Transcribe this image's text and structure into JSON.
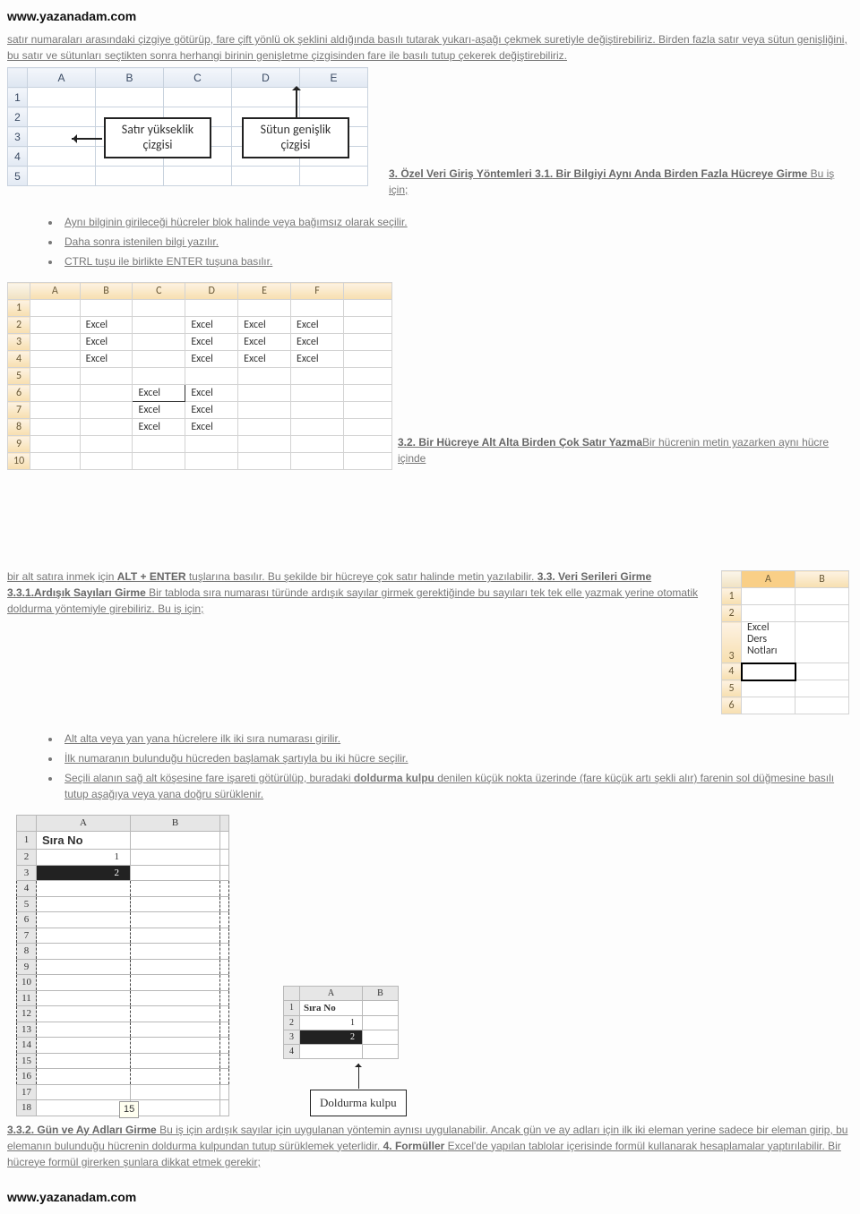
{
  "site": "www.yazanadam.com",
  "intro": "satır numaraları arasındaki çizgiye götürüp, fare çift yönlü ok şeklini aldığında basılı tutarak yukarı-aşağı çekmek suretiyle değiştirebiliriz. Birden fazla satır veya sütun genişliğini, bu satır ve sütunları seçtikten sonra herhangi birinin genişletme çizgisinden fare ile basılı tutup çekerek değiştirebiliriz.",
  "fig1": {
    "cols": [
      "A",
      "B",
      "C",
      "D",
      "E"
    ],
    "rows": [
      "1",
      "2",
      "3",
      "4",
      "5"
    ],
    "callout_row": "Satır yükseklik çizgisi",
    "callout_col": "Sütun genişlik çizgisi"
  },
  "sec3": {
    "heading": " 3. Özel Veri Giriş Yöntemleri 3.1. Bir Bilgiyi Aynı Anda Birden Fazla Hücreye Girme ",
    "tail": "Bu iş için;"
  },
  "bullets3_1": [
    "Aynı bilginin girileceği hücreler blok halinde veya bağımsız olarak seçilir.",
    "Daha sonra istenilen bilgi yazılır.",
    "CTRL tuşu ile birlikte ENTER tuşuna basılır."
  ],
  "fig2": {
    "cols": [
      "A",
      "B",
      "C",
      "D",
      "E",
      "F"
    ],
    "rows": [
      "1",
      "2",
      "3",
      "4",
      "5",
      "6",
      "7",
      "8",
      "9",
      "10"
    ],
    "cells": {
      "B2": "Excel",
      "D2": "Excel",
      "E2": "Excel",
      "F2": "Excel",
      "B3": "Excel",
      "D3": "Excel",
      "E3": "Excel",
      "F3": "Excel",
      "B4": "Excel",
      "D4": "Excel",
      "E4": "Excel",
      "F4": "Excel",
      "C6": "Excel",
      "D6": "Excel",
      "C7": "Excel",
      "D7": "Excel",
      "C8": "Excel",
      "D8": "Excel"
    }
  },
  "sec32": {
    "heading": " 3.2. Bir Hücreye Alt Alta Birden Çok Satır Yazma",
    "tail": "Bir hücrenin metin yazarken aynı hücre içinde"
  },
  "fig3": {
    "cols": [
      "A",
      "B"
    ],
    "rows": [
      "1",
      "2",
      "3",
      "4",
      "5",
      "6"
    ],
    "multiline": "Excel\nDers\nNotları"
  },
  "sec33_pre": "bir alt satıra inmek için ",
  "sec33_key": "ALT + ENTER",
  "sec33_post": " tuşlarına basılır. Bu şekilde bir hücreye çok satır halinde metin yazılabilir.",
  "sec33_head": " 3.3. Veri Serileri Girme 3.3.1.Ardışık Sayıları Girme ",
  "sec33_body": "Bir tabloda sıra numarası türünde ardışık sayılar girmek gerektiğinde bu sayıları tek tek elle yazmak yerine otomatik doldurma yöntemiyle girebiliriz. Bu iş için;",
  "bullets3_3": [
    {
      "t": "Alt alta veya yan yana hücrelere ilk iki sıra numarası girilir."
    },
    {
      "t": "İlk numaranın bulunduğu hücreden başlamak şartıyla bu iki hücre seçilir."
    },
    {
      "pre": "Seçili alanın sağ alt köşesine fare işareti götürülüp, buradaki ",
      "b": "doldurma kulpu",
      "post": " denilen küçük nokta üzerinde (fare küçük artı şekli alır) farenin sol düğmesine basılı tutup aşağıya veya yana doğru sürüklenir."
    }
  ],
  "fig4a": {
    "header": "Sıra No",
    "vals": [
      "1",
      "2"
    ],
    "rows": 18,
    "tip": "15"
  },
  "fig4b": {
    "header": "Sıra No",
    "vals": [
      "1",
      "2"
    ],
    "callout": "Doldurma kulpu"
  },
  "sec332": {
    "heading": " 3.3.2. Gün ve Ay Adları Girme ",
    "body": "Bu iş için ardışık sayılar için uygulanan yöntemin aynısı uygulanabilir. Ancak gün ve ay adları için ilk iki eleman yerine sadece bir eleman girip, bu elemanın bulunduğu hücrenin doldurma kulpundan tutup sürüklemek yeterlidir. ",
    "heading2": "4. Formüller ",
    "body2": "Excel'de yapılan tablolar içerisinde formül kullanarak hesaplamalar yaptırılabilir. Bir hücreye formül girerken şunlara dikkat etmek gerekir;"
  },
  "footer": "www.yazanadam.com"
}
